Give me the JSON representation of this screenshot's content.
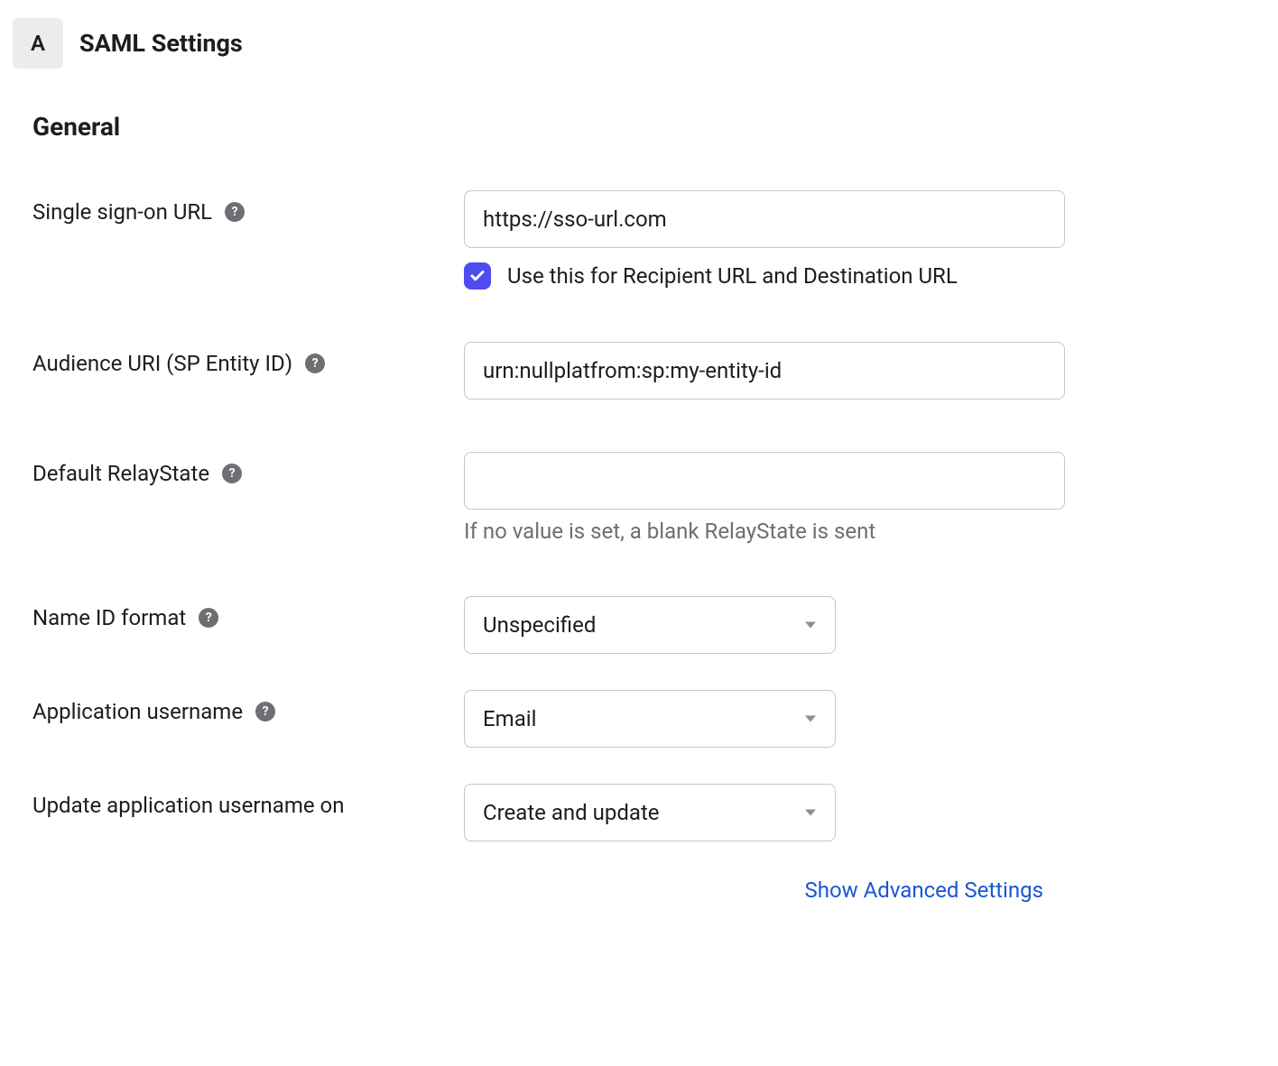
{
  "header": {
    "badge": "A",
    "title": "SAML Settings"
  },
  "section": {
    "title": "General"
  },
  "fields": {
    "sso_url": {
      "label": "Single sign-on URL",
      "value": "https://sso-url.com",
      "checkbox_label": "Use this for Recipient URL and Destination URL",
      "checkbox_checked": true
    },
    "audience_uri": {
      "label": "Audience URI (SP Entity ID)",
      "value": "urn:nullplatfrom:sp:my-entity-id"
    },
    "relay_state": {
      "label": "Default RelayState",
      "value": "",
      "helper": "If no value is set, a blank RelayState is sent"
    },
    "name_id_format": {
      "label": "Name ID format",
      "value": "Unspecified"
    },
    "app_username": {
      "label": "Application username",
      "value": "Email"
    },
    "update_username_on": {
      "label": "Update application username on",
      "value": "Create and update"
    }
  },
  "footer": {
    "advanced_link": "Show Advanced Settings"
  }
}
